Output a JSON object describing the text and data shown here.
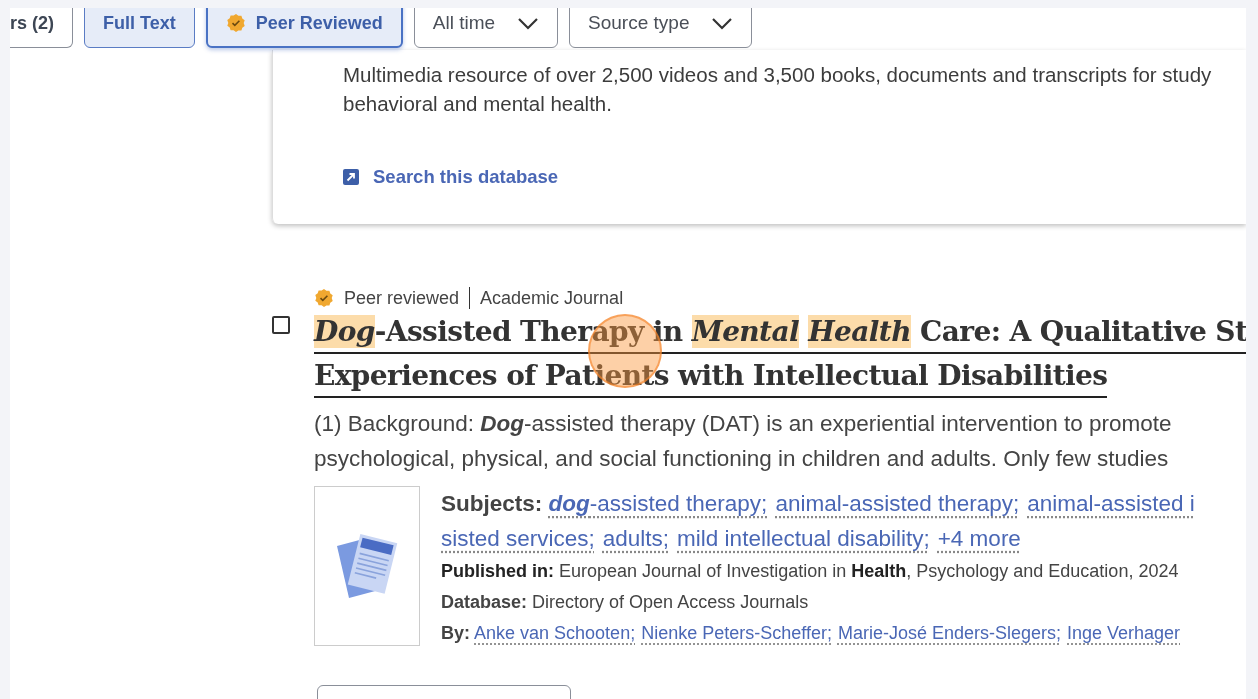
{
  "filters": [
    {
      "label": "rs (2)",
      "kind": "chip",
      "selected": false,
      "focused": false
    },
    {
      "label": "Full Text",
      "kind": "chip",
      "selected": true,
      "focused": false
    },
    {
      "label": "Peer Reviewed",
      "kind": "badge-chip",
      "selected": true,
      "focused": true
    },
    {
      "label": "All time",
      "kind": "dropdown",
      "selected": false,
      "focused": false
    },
    {
      "label": "Source type",
      "kind": "dropdown",
      "selected": false,
      "focused": false
    }
  ],
  "database_card": {
    "description_lines": [
      "Multimedia resource of over 2,500 videos and 3,500 books, documents and transcripts for study",
      "behavioral and mental health."
    ],
    "link": "Search this database"
  },
  "result": {
    "checked": false,
    "peer_reviewed": true,
    "peer_label": "Peer reviewed",
    "source_type": "Academic Journal",
    "title_lines": [
      "*Dog*-Assisted Therapy in *Mental* *Health* Care: A Qualitative St",
      "Experiences of Patients with Intellectual Disabilities"
    ],
    "abstract_lines": [
      "(1) Background: **Dog**-assisted therapy (DAT) is an experiential intervention to promote",
      "psychological, physical, and social functioning in children and adults. Only few studies"
    ],
    "subjects_label": "Subjects:",
    "subject_lines": [
      [
        {
          "text": "**dog**-assisted therapy",
          "sep": ";"
        },
        {
          "text": "animal-assisted therapy",
          "sep": ";"
        },
        {
          "text": "animal-assisted i"
        }
      ],
      [
        {
          "text": "sisted services",
          "sep": ";"
        },
        {
          "text": "adults",
          "sep": ";"
        },
        {
          "text": "mild intellectual disability",
          "sep": ";"
        },
        {
          "text": "+4 more"
        }
      ]
    ],
    "published_label": "Published in:",
    "published": "European Journal of Investigation in **Health**, Psychology and Education, 2024",
    "database_label": "Database:",
    "database": "Directory of Open Access Journals",
    "by_label": "By:",
    "authors": [
      {
        "text": "Anke van Schooten",
        "sep": ";"
      },
      {
        "text": "Nienke Peters-Scheffer",
        "sep": ";"
      },
      {
        "text": "Marie-José Enders-Slegers",
        "sep": ";"
      },
      {
        "text": "Inge Verhager"
      }
    ]
  }
}
